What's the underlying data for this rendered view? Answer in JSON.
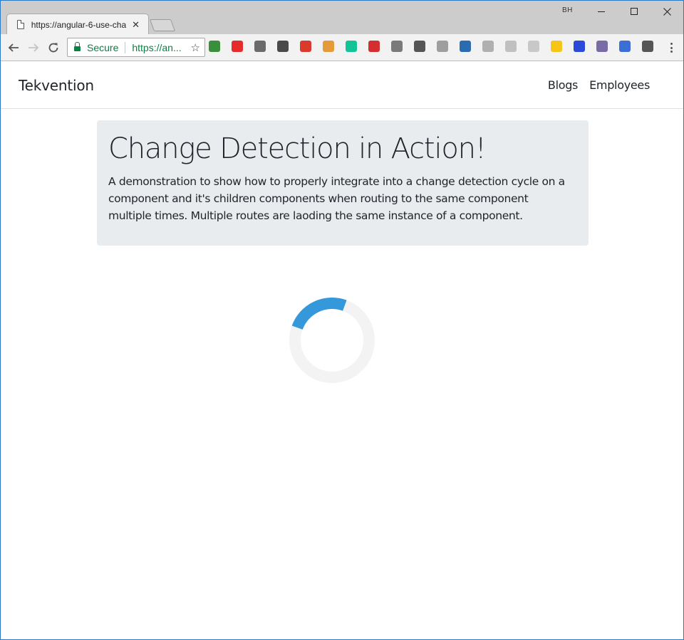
{
  "browser": {
    "tab_title": "https://angular-6-use-cha",
    "tab_close": "✕",
    "profile_badge": "BH",
    "secure_label": "Secure",
    "url_display": "https://an...",
    "extensions": [
      {
        "name": "extension-green-arrow",
        "color": "#3a8f3a"
      },
      {
        "name": "extension-opera",
        "color": "#e52b2b"
      },
      {
        "name": "extension-penguin",
        "color": "#6b6b6b"
      },
      {
        "name": "extension-bird",
        "color": "#4a4a4a"
      },
      {
        "name": "extension-wad",
        "color": "#d93a2b"
      },
      {
        "name": "extension-ruler",
        "color": "#e49c3a"
      },
      {
        "name": "extension-grammarly",
        "color": "#15c39a"
      },
      {
        "name": "extension-red-dots",
        "color": "#d32f2f"
      },
      {
        "name": "extension-braces",
        "color": "#7a7a7a"
      },
      {
        "name": "extension-film",
        "color": "#555555"
      },
      {
        "name": "extension-circle",
        "color": "#9e9e9e"
      },
      {
        "name": "extension-spy",
        "color": "#2b6cb0"
      },
      {
        "name": "extension-shield",
        "color": "#b0b0b0"
      },
      {
        "name": "extension-tree",
        "color": "#c0c0c0"
      },
      {
        "name": "extension-target",
        "color": "#c8c8c8"
      },
      {
        "name": "extension-yellow-moon",
        "color": "#f5c518"
      },
      {
        "name": "extension-blue-flag",
        "color": "#2a4ad8"
      },
      {
        "name": "extension-cat",
        "color": "#7a6aa8"
      },
      {
        "name": "extension-blue-square",
        "color": "#3b6fd6"
      },
      {
        "name": "extension-pen",
        "color": "#555555"
      }
    ]
  },
  "site": {
    "brand": "Tekvention",
    "nav_links": [
      "Blogs",
      "Employees"
    ]
  },
  "jumbotron": {
    "title": "Change Detection in Action!",
    "lead": "A demonstration to show how to properly integrate into a change detection cycle on a component and it's children components when routing to the same component multiple times. Multiple routes are laoding the same instance of a component."
  },
  "spinner": {
    "track_color": "#f3f3f3",
    "arc_color": "#3498db"
  }
}
